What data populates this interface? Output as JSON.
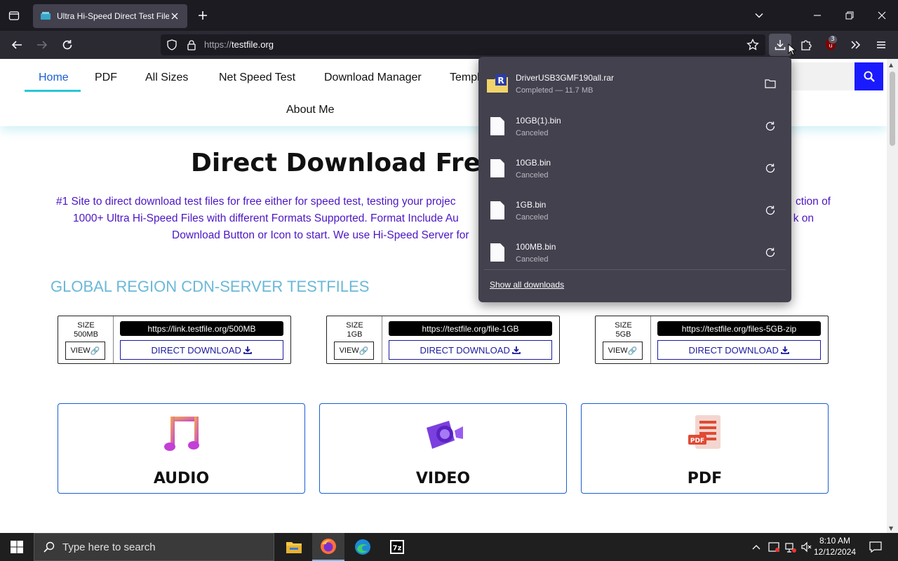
{
  "browser": {
    "tab": {
      "title": "Ultra Hi-Speed Direct Test Files ("
    },
    "url": {
      "protocol": "https://",
      "host": "testfile.org"
    },
    "extension_badge": "3"
  },
  "site": {
    "menu": [
      "Home",
      "PDF",
      "All Sizes",
      "Net Speed Test",
      "Download Manager",
      "Templ",
      "About Me"
    ],
    "hero_title": "Direct Download Free S",
    "hero_desc": [
      "#1 Site to direct download test files for free either for speed test, testing your projec",
      "ction of",
      "1000+  Ultra Hi-Speed Files with different Formats Supported. Format Include Au",
      "k on",
      "Download Button or Icon to start. We use Hi-Speed Server for"
    ],
    "cdn_heading": "GLOBAL REGION CDN-SERVER TESTFILES",
    "cdn_cards": [
      {
        "size_label": "SIZE",
        "size_value": "500MB",
        "view": "VIEW",
        "link": "https://link.testfile.org/500MB",
        "download": "DIRECT DOWNLOAD"
      },
      {
        "size_label": "SIZE",
        "size_value": "1GB",
        "view": "VIEW",
        "link": "https://testfile.org/file-1GB",
        "download": "DIRECT DOWNLOAD"
      },
      {
        "size_label": "SIZE",
        "size_value": "5GB",
        "view": "VIEW",
        "link": "https://testfile.org/files-5GB-zip",
        "download": "DIRECT DOWNLOAD"
      }
    ],
    "categories": [
      "AUDIO",
      "VIDEO",
      "PDF"
    ]
  },
  "downloads": {
    "items": [
      {
        "name": "DriverUSB3GMF190all.rar",
        "status": "Completed — 11.7 MB",
        "action": "open-folder"
      },
      {
        "name": "10GB(1).bin",
        "status": "Canceled",
        "action": "retry"
      },
      {
        "name": "10GB.bin",
        "status": "Canceled",
        "action": "retry"
      },
      {
        "name": "1GB.bin",
        "status": "Canceled",
        "action": "retry"
      },
      {
        "name": "100MB.bin",
        "status": "Canceled",
        "action": "retry"
      }
    ],
    "show_all": "Show all downloads"
  },
  "taskbar": {
    "search_placeholder": "Type here to search",
    "time": "8:10 AM",
    "date": "12/12/2024"
  },
  "colors": {
    "accent_blue": "#1a5fd1",
    "search_button": "#1a1aff",
    "hero_text": "#4b16c4",
    "cdn_heading": "#6ab8d8",
    "panel_bg": "#42414d"
  }
}
